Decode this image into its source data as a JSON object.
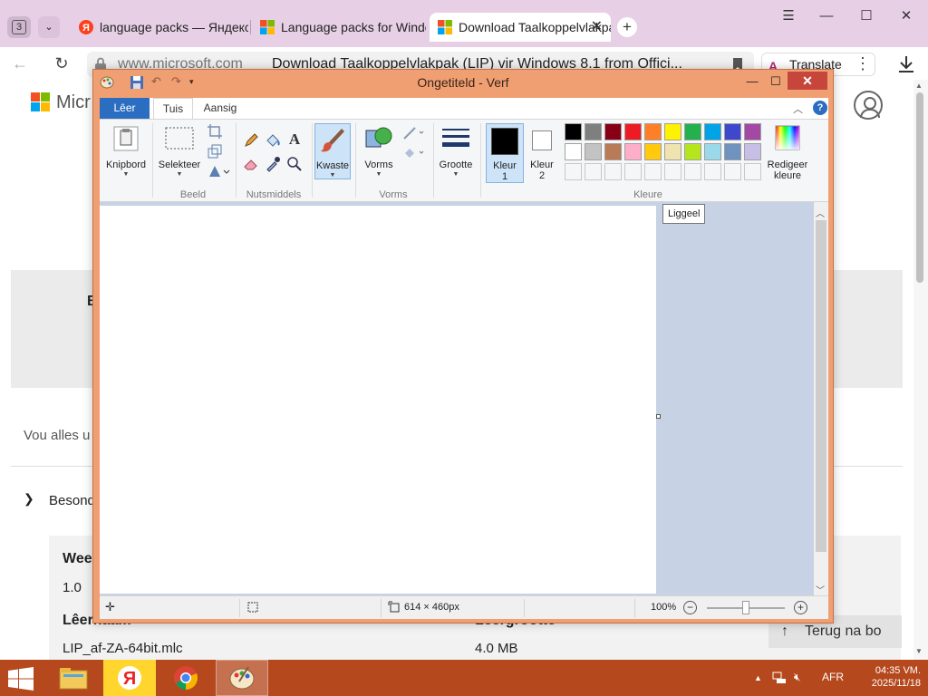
{
  "browser": {
    "tab_count": "3",
    "tabs": [
      {
        "label": "language packs — Яндекс",
        "active": false
      },
      {
        "label": "Language packs for Windows",
        "active": false
      },
      {
        "label": "Download Taalkoppelvlakpak",
        "active": true
      }
    ],
    "address": {
      "domain": "www.microsoft.com",
      "title": "Download Taalkoppelvlakpak (LIP) vir Windows 8.1 from Offici..."
    },
    "translate_label": "Translate"
  },
  "webpage": {
    "logo_text": "Micr",
    "hero_letter": "B",
    "intro_text": "Vou alles u",
    "section_label": "Besonde",
    "card": {
      "weergawe_label": "Wee",
      "weergawe_value": "1.0",
      "leernaam_label": "Lêernaam",
      "leergrootte_label": "Lêergrootte",
      "file_name": "LIP_af-ZA-64bit.mlc",
      "file_size": "4.0 MB"
    },
    "back_to_top": "Terug na bo"
  },
  "paint": {
    "title": "Ongetiteld - Verf",
    "tabs": {
      "file": "Lêer",
      "home": "Tuis",
      "view": "Aansig"
    },
    "ribbon": {
      "clipboard": "Knipbord",
      "select": "Selekteer",
      "image_group": "Beeld",
      "tools_group": "Nutsmiddels",
      "brushes": "Kwaste",
      "shapes": "Vorms",
      "shapes_group": "Vorms",
      "size": "Grootte",
      "color1_line1": "Kleur",
      "color1_line2": "1",
      "color2_line1": "Kleur",
      "color2_line2": "2",
      "edit_colors_line1": "Redigeer",
      "edit_colors_line2": "kleure",
      "colors_group": "Kleure"
    },
    "palette_row1": [
      "#000000",
      "#7f7f7f",
      "#880015",
      "#ed1c24",
      "#ff7f27",
      "#fff200",
      "#22b14c",
      "#00a2e8",
      "#3f48cc",
      "#a349a4"
    ],
    "palette_row2": [
      "#ffffff",
      "#c3c3c3",
      "#b97a57",
      "#ffaec9",
      "#ffc90e",
      "#efe4b0",
      "#b5e61d",
      "#99d9ea",
      "#7092be",
      "#c8bfe7"
    ],
    "tooltip": "Liggeel",
    "status": {
      "canvas_size": "614 × 460px",
      "zoom": "100%"
    }
  },
  "taskbar": {
    "language": "AFR",
    "time": "04:35 VM.",
    "date": "2025/11/18"
  }
}
